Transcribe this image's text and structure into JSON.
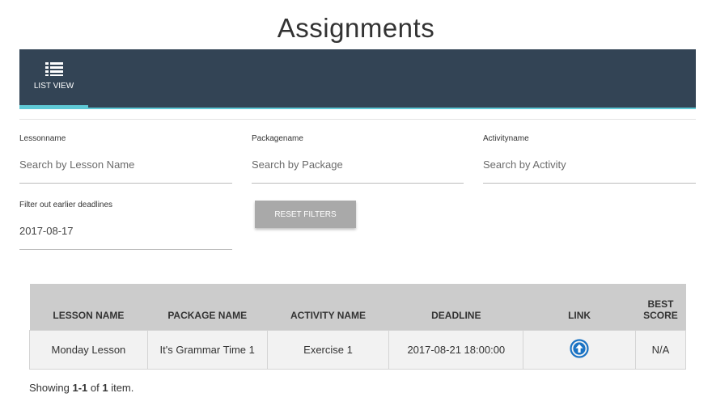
{
  "page": {
    "title": "Assignments"
  },
  "nav": {
    "tabs": [
      {
        "label": "LIST VIEW",
        "icon": "list-icon",
        "active": true
      }
    ],
    "colors": {
      "bar": "#334455",
      "accent": "#5fc9d6"
    }
  },
  "filters": {
    "lesson": {
      "label": "Lessonname",
      "placeholder": "Search by Lesson Name",
      "value": ""
    },
    "package": {
      "label": "Packagename",
      "placeholder": "Search by Package",
      "value": ""
    },
    "activity": {
      "label": "Activityname",
      "placeholder": "Search by Activity",
      "value": ""
    },
    "deadline": {
      "label": "Filter out earlier deadlines",
      "value": "2017-08-17"
    },
    "reset_label": "RESET FILTERS"
  },
  "table": {
    "headers": {
      "lesson": "LESSON NAME",
      "package": "PACKAGE NAME",
      "activity": "ACTIVITY NAME",
      "deadline": "DEADLINE",
      "link": "LINK",
      "best_score_line1": "BEST",
      "best_score_line2": "SCORE"
    },
    "rows": [
      {
        "lesson": "Monday Lesson",
        "package": "It's Grammar Time 1",
        "activity": "Exercise 1",
        "deadline": "2017-08-21 18:00:00",
        "link_icon": "arrow-up-circle-icon",
        "best_score": "N/A"
      }
    ]
  },
  "summary": {
    "prefix": "Showing ",
    "range": "1-1",
    "of": " of ",
    "total": "1",
    "suffix": " item."
  }
}
